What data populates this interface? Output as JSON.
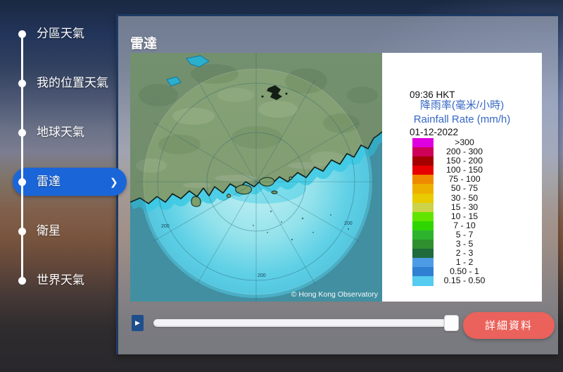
{
  "sidebar": {
    "accent_color": "#1A66D9",
    "chevron": "❯",
    "items": [
      {
        "label": "分區天氣",
        "selected": false
      },
      {
        "label": "我的位置天氣",
        "selected": false
      },
      {
        "label": "地球天氣",
        "selected": false
      },
      {
        "label": "雷達",
        "selected": true
      },
      {
        "label": "衛星",
        "selected": false
      },
      {
        "label": "世界天氣",
        "selected": false
      }
    ]
  },
  "panel": {
    "title": "雷達"
  },
  "radar_map": {
    "copyright": "© Hong Kong Observatory",
    "range_ring_label": "200"
  },
  "legend": {
    "time": "09:36 HKT",
    "date": "01-12-2022",
    "title_zh": "降雨率(毫米/小時)",
    "title_en": "Rainfall Rate (mm/h)",
    "title_color": "#3567C4",
    "scale": [
      {
        "range": ">300",
        "color": "#DF00DF"
      },
      {
        "range": "200 - 300",
        "color": "#CE0058"
      },
      {
        "range": "150 - 200",
        "color": "#A40000"
      },
      {
        "range": "100 - 150",
        "color": "#E60000"
      },
      {
        "range": "75 - 100",
        "color": "#EE8A00"
      },
      {
        "range": "50 - 75",
        "color": "#EEB000"
      },
      {
        "range": "30 - 50",
        "color": "#E8CB00"
      },
      {
        "range": "15 - 30",
        "color": "#CCD34A"
      },
      {
        "range": "10 - 15",
        "color": "#63E300"
      },
      {
        "range": "7 - 10",
        "color": "#2FD500"
      },
      {
        "range": "5 - 7",
        "color": "#2EB32E"
      },
      {
        "range": "3 - 5",
        "color": "#2E8F2E"
      },
      {
        "range": "2 - 3",
        "color": "#1F6B3C"
      },
      {
        "range": "1 - 2",
        "color": "#4D9BE4"
      },
      {
        "range": "0.50 - 1",
        "color": "#2F80D2"
      },
      {
        "range": "0.15 - 0.50",
        "color": "#55CBF0"
      }
    ]
  },
  "controls": {
    "play_icon": "▶",
    "details_label": "詳細資料",
    "details_color": "#EA625B"
  }
}
